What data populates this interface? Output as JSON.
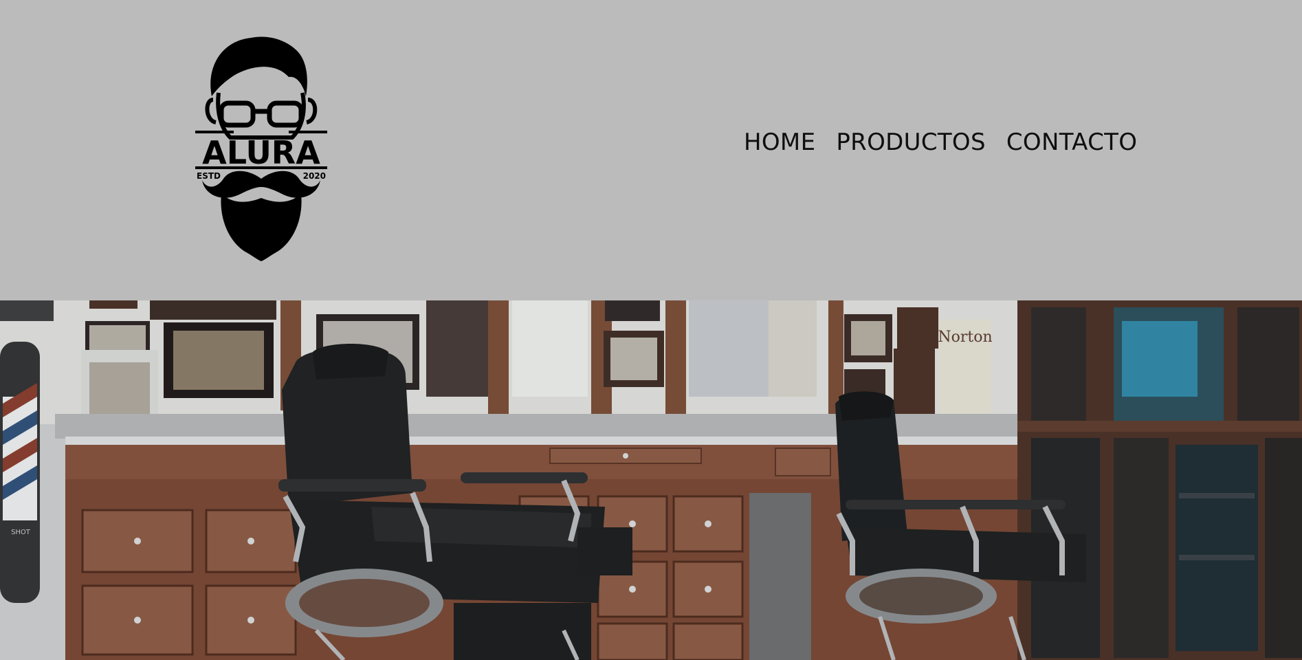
{
  "logo": {
    "brand": "ALURA",
    "left_text": "ESTD",
    "right_text": "2020",
    "icon": "bearded-man-with-glasses-logo"
  },
  "nav": {
    "items": [
      {
        "label": "HOME"
      },
      {
        "label": "PRODUCTOS"
      },
      {
        "label": "CONTACTO"
      }
    ]
  },
  "hero": {
    "sign_text": "Norton",
    "pole_text": "SHOT"
  },
  "colors": {
    "header_bg": "#bbbbbb",
    "nav_text": "#0e0e0e",
    "wood": "#7a4530",
    "leather": "#1e1e1f"
  }
}
